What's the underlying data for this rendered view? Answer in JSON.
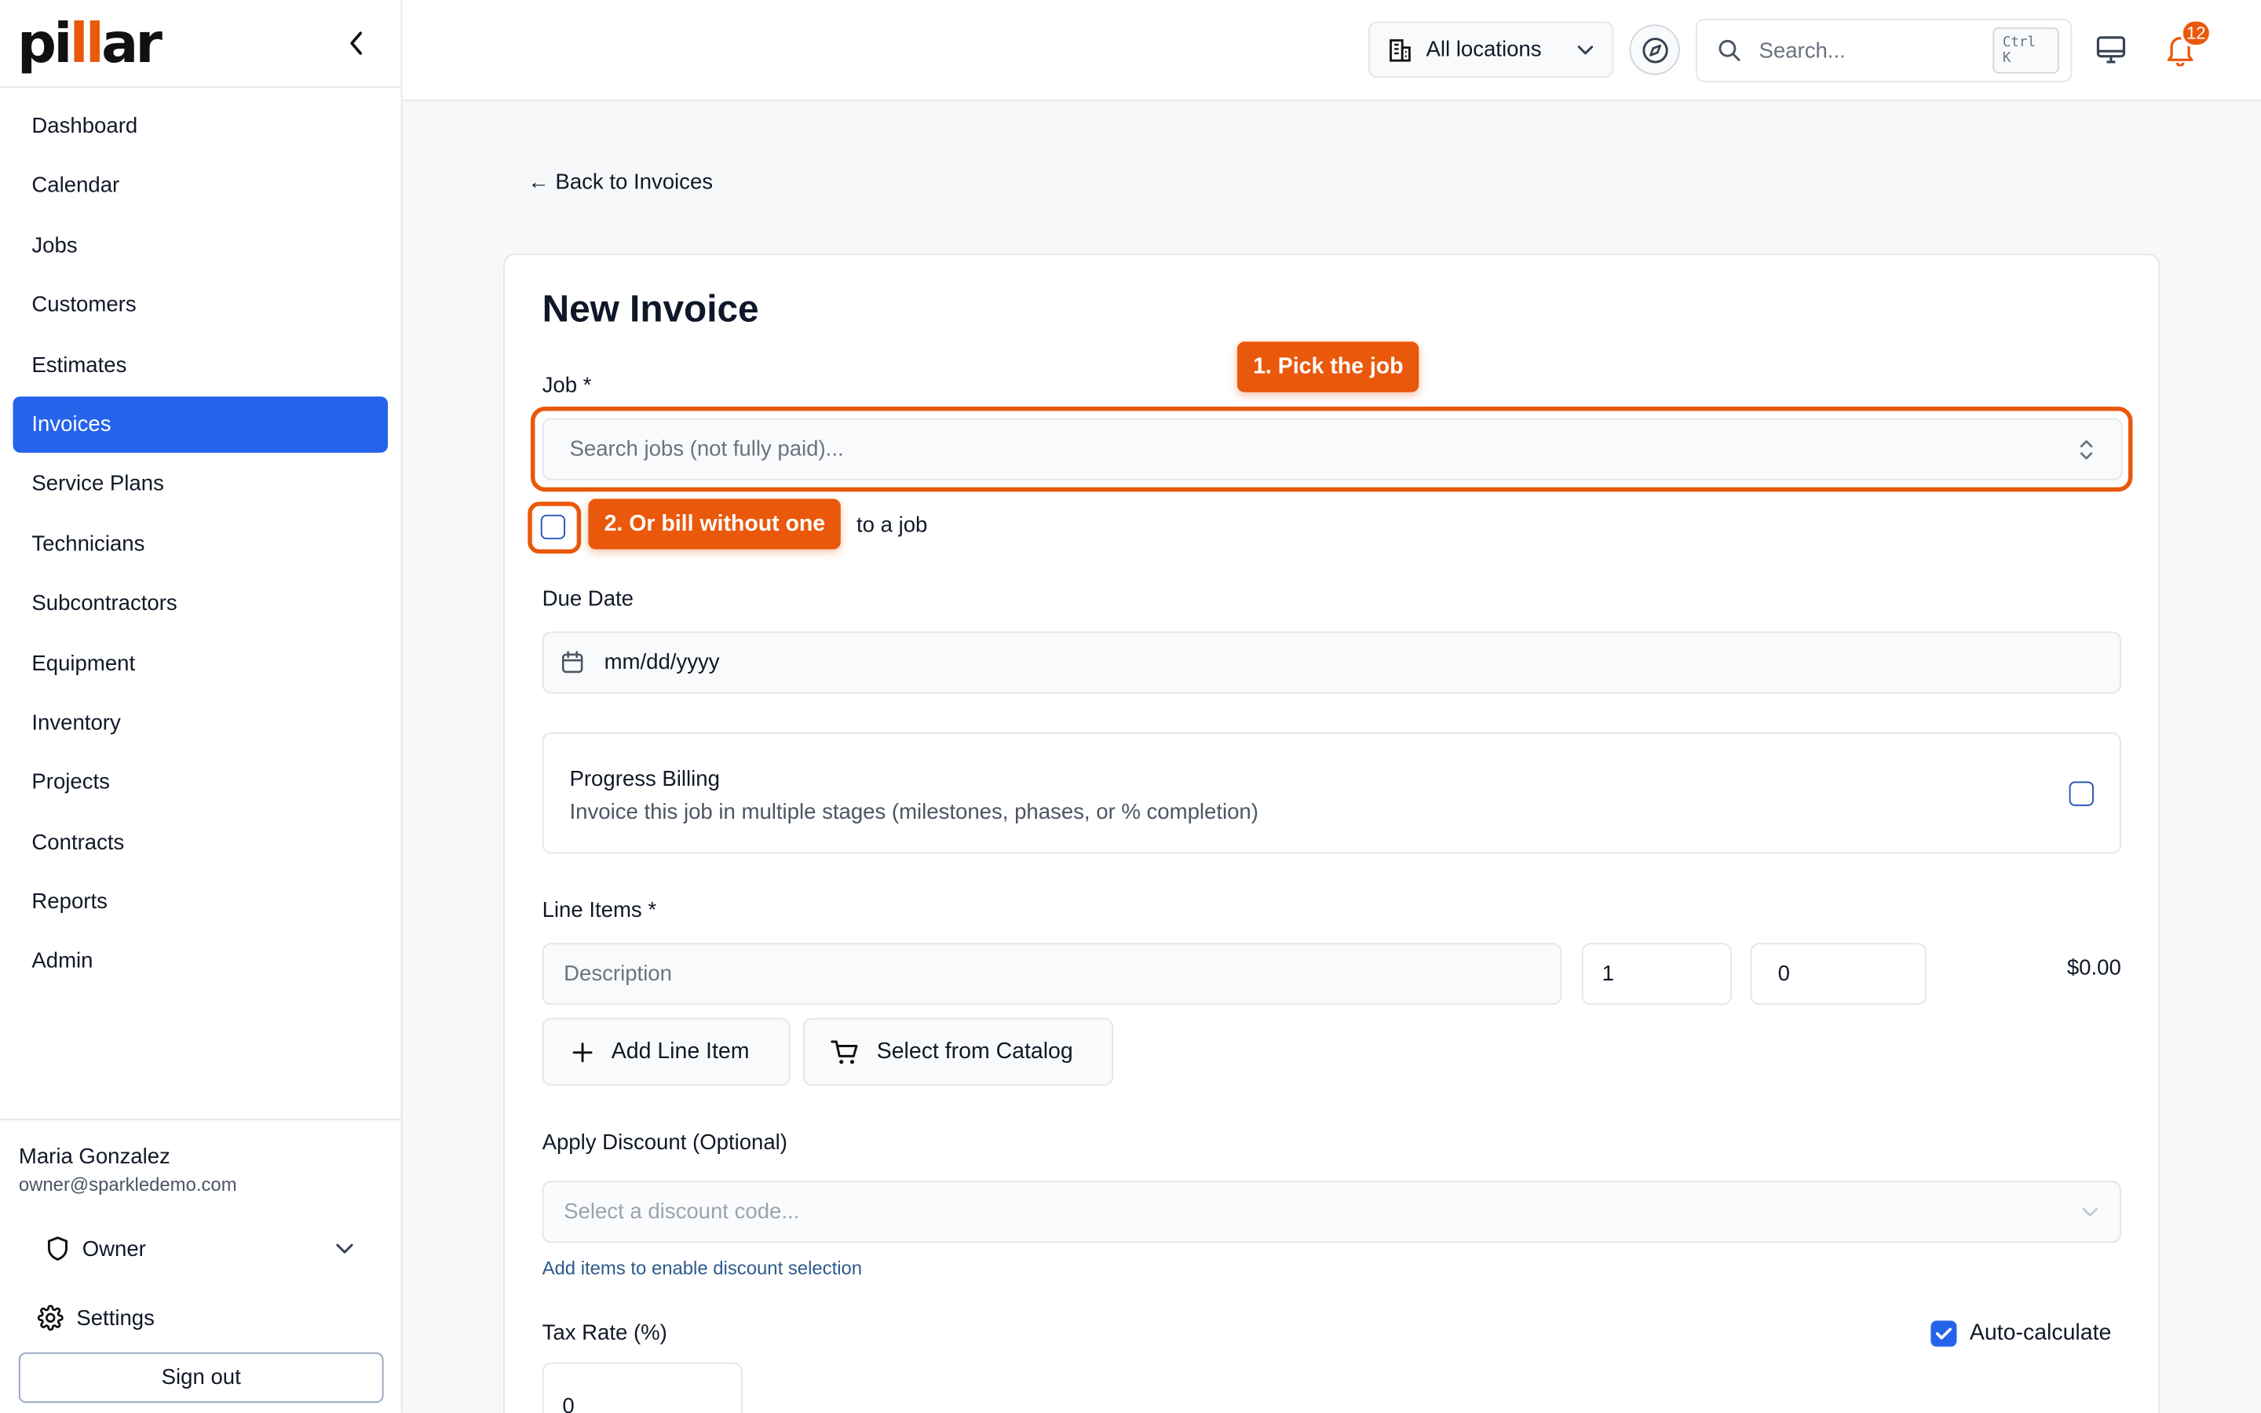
{
  "brand": {
    "logo_pre": "pi",
    "logo_bar": "ll",
    "logo_post": "ar",
    "accent": "#ea580c",
    "primary": "#2563eb"
  },
  "sidebar": {
    "items": [
      {
        "label": "Dashboard"
      },
      {
        "label": "Calendar"
      },
      {
        "label": "Jobs"
      },
      {
        "label": "Customers"
      },
      {
        "label": "Estimates"
      },
      {
        "label": "Invoices",
        "active": true
      },
      {
        "label": "Service Plans"
      },
      {
        "label": "Technicians"
      },
      {
        "label": "Subcontractors"
      },
      {
        "label": "Equipment"
      },
      {
        "label": "Inventory"
      },
      {
        "label": "Projects"
      },
      {
        "label": "Contracts"
      },
      {
        "label": "Reports"
      },
      {
        "label": "Admin"
      }
    ],
    "user": {
      "name": "Maria Gonzalez",
      "email": "owner@sparkledemo.com",
      "role": "Owner"
    },
    "settings_label": "Settings",
    "signout_label": "Sign out"
  },
  "topbar": {
    "location_label": "All locations",
    "search_placeholder": "Search...",
    "search_shortcut": "Ctrl K",
    "notification_count": "12"
  },
  "main": {
    "back_label": "← Back to Invoices",
    "title": "New Invoice",
    "job": {
      "label": "Job *",
      "placeholder": "Search jobs (not fully paid)..."
    },
    "no_job_text_tail": "to a job",
    "callouts": {
      "pick_job": "1. Pick the job",
      "bill_without": "2. Or bill without one"
    },
    "due_date": {
      "label": "Due Date",
      "placeholder": "mm/dd/yyyy"
    },
    "progress_billing": {
      "title": "Progress Billing",
      "description": "Invoice this job in multiple stages (milestones, phases, or % completion)"
    },
    "line_items": {
      "label": "Line Items *",
      "description_placeholder": "Description",
      "quantity": "1",
      "price": "0",
      "total": "$0.00",
      "add_label": "Add Line Item",
      "catalog_label": "Select from Catalog"
    },
    "discount": {
      "label": "Apply Discount (Optional)",
      "placeholder": "Select a discount code...",
      "hint": "Add items to enable discount selection"
    },
    "tax": {
      "label": "Tax Rate (%)",
      "value": "0",
      "auto_label": "Auto-calculate",
      "auto_checked": true
    }
  }
}
